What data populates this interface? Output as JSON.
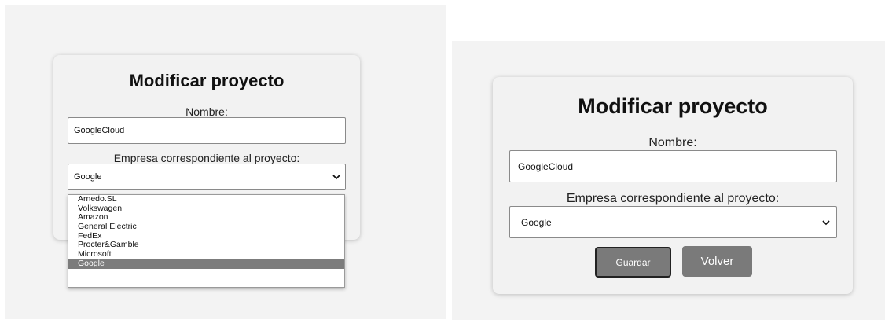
{
  "form": {
    "title": "Modificar proyecto",
    "name_label": "Nombre:",
    "name_value": "GoogleCloud",
    "company_label": "Empresa correspondiente al proyecto:",
    "company_selected": "Google",
    "save_label": "Guardar",
    "back_label": "Volver"
  },
  "dropdown": {
    "options": [
      "Arnedo.SL",
      "Volkswagen",
      "Amazon",
      "General Electric",
      "FedEx",
      "Procter&Gamble",
      "Microsoft",
      "Google"
    ],
    "highlighted": "Google"
  },
  "colors": {
    "panel_bg": "#f3f3f3",
    "card_bg": "#f2f2f2",
    "button_bg": "#7a7a7a",
    "highlight_bg": "#7c7c7c"
  },
  "icons": [
    "chevron-down-icon"
  ]
}
